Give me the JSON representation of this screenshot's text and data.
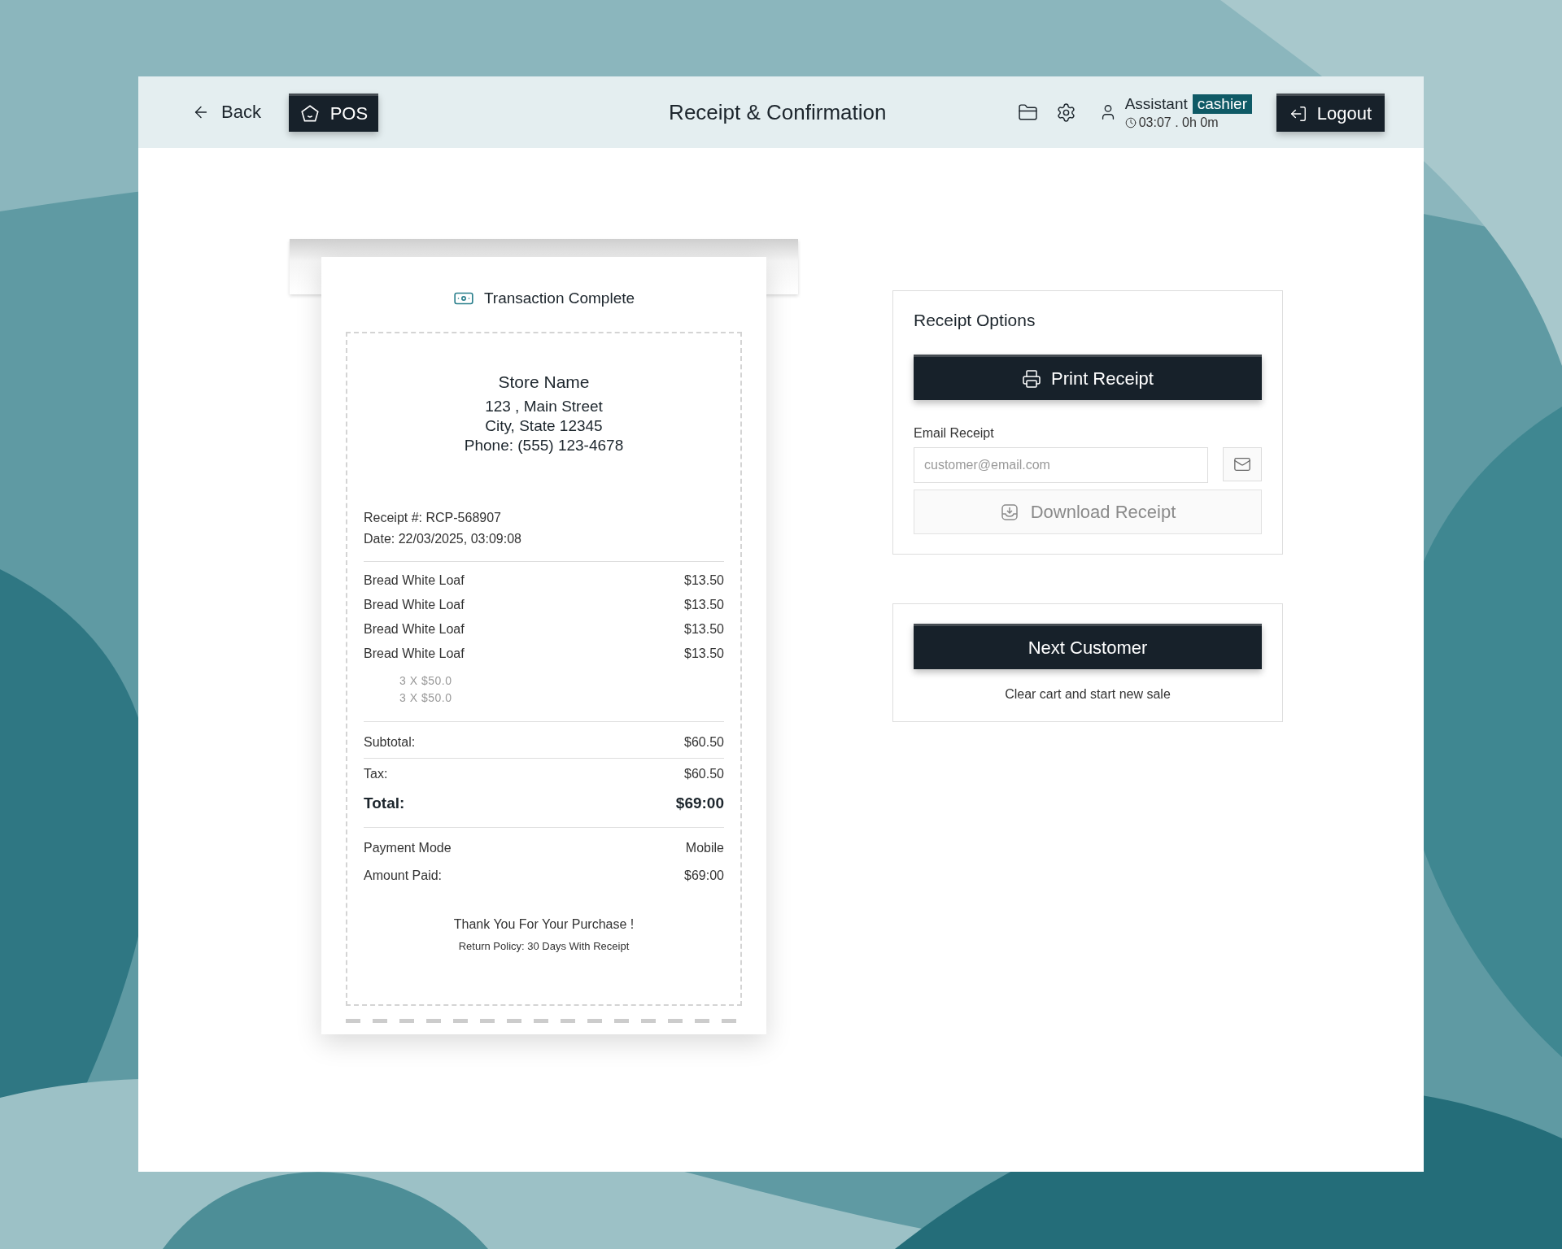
{
  "header": {
    "back": "Back",
    "app_button": "POS",
    "title": "Receipt & Confirmation",
    "user": {
      "name": "Assistant",
      "role": "cashier",
      "time": "03:07 . 0h 0m"
    },
    "logout": "Logout"
  },
  "receipt": {
    "status": "Transaction Complete",
    "store": {
      "name": "Store Name",
      "lines": [
        "123 , Main Street",
        "City, State 12345",
        "Phone: (555) 123-4678"
      ]
    },
    "meta": [
      "Receipt #: RCP-568907",
      "Date: 22/03/2025, 03:09:08"
    ],
    "items": [
      {
        "name": "Bread White Loaf",
        "price": "$13.50"
      },
      {
        "name": "Bread White Loaf",
        "price": "$13.50"
      },
      {
        "name": "Bread White Loaf",
        "price": "$13.50"
      },
      {
        "name": "Bread White Loaf",
        "price": "$13.50"
      }
    ],
    "quantities": [
      "3 X $50.0",
      "3 X $50.0"
    ],
    "totals": [
      {
        "label": "Subtotal:",
        "value": "$60.50",
        "kind": "ruled"
      },
      {
        "label": "Tax:",
        "value": "$60.50",
        "kind": "plain"
      },
      {
        "label": "Total:",
        "value": "$69:00",
        "kind": "grand"
      }
    ],
    "payment": [
      {
        "label": "Payment Mode",
        "value": "Mobile"
      },
      {
        "label": "Amount Paid:",
        "value": "$69:00"
      }
    ],
    "thank_you": "Thank You For Your Purchase !",
    "policy": "Return Policy: 30 Days With Receipt"
  },
  "options": {
    "title": "Receipt Options",
    "print": "Print Receipt",
    "email_label": "Email Receipt",
    "email_placeholder": "customer@email.com",
    "download": {
      "label": "Download Receipt",
      "disabled": true
    }
  },
  "next": {
    "button": "Next Customer",
    "hint": "Clear cart and start new sale"
  }
}
